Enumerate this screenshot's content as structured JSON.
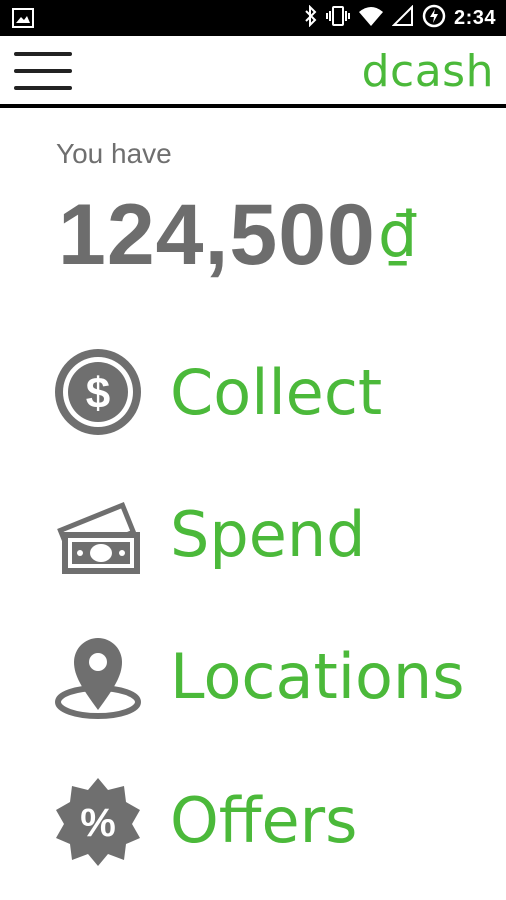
{
  "status_bar": {
    "time": "2:34",
    "icons": [
      "image-icon",
      "bluetooth-icon",
      "vibrate-icon",
      "wifi-icon",
      "signal-icon",
      "battery-saver-icon"
    ]
  },
  "app_bar": {
    "brand": "dcash",
    "menu_icon": "hamburger-menu-icon"
  },
  "balance": {
    "label": "You have",
    "amount": "124,500",
    "currency_symbol": "₫"
  },
  "menu": [
    {
      "label": "Collect",
      "icon": "dollar-coin-icon"
    },
    {
      "label": "Spend",
      "icon": "cash-bills-icon"
    },
    {
      "label": "Locations",
      "icon": "location-pin-icon"
    },
    {
      "label": "Offers",
      "icon": "percent-badge-icon"
    }
  ],
  "colors": {
    "accent": "#4bb93a",
    "text_gray": "#6d6d6d",
    "icon_gray": "#6f6f6f",
    "status_bar": "#000000"
  }
}
